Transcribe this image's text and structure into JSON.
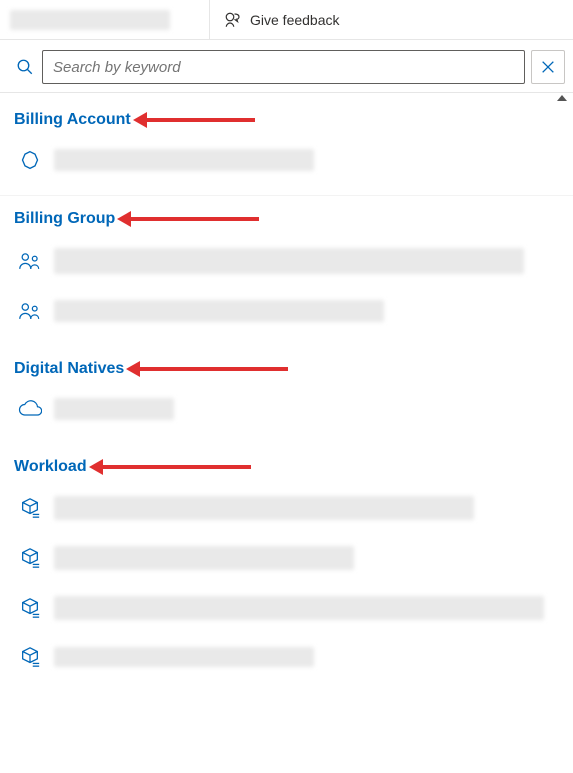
{
  "topbar": {
    "feedback_label": "Give feedback"
  },
  "search": {
    "placeholder": "Search by keyword",
    "value": ""
  },
  "sections": {
    "billing_account": {
      "label": "Billing Account"
    },
    "billing_group": {
      "label": "Billing Group"
    },
    "digital_natives": {
      "label": "Digital Natives"
    },
    "workload": {
      "label": "Workload"
    }
  },
  "colors": {
    "accent": "#0067b8",
    "arrow": "#e02f2f"
  }
}
